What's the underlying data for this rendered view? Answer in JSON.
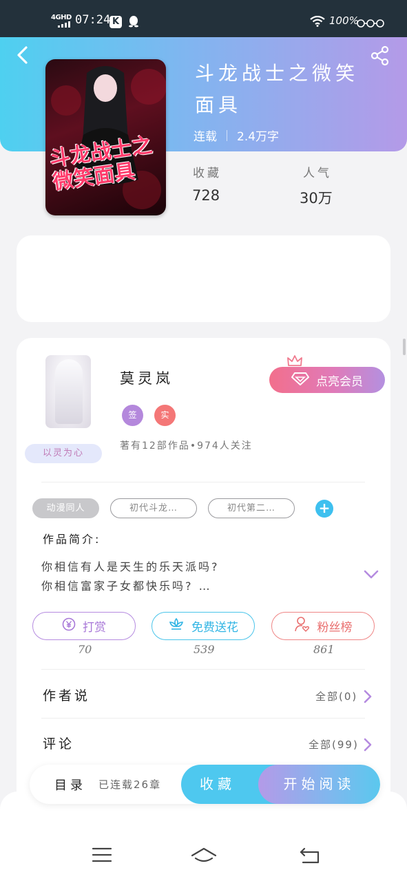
{
  "status_bar": {
    "network": "4GHD",
    "time": "07:24",
    "app_k": "K",
    "battery": "100%"
  },
  "book": {
    "title": "斗龙战士之微笑面具",
    "cover_art_text": "斗龙战士之微笑面具",
    "status": "连载",
    "word_count": "2.4万字",
    "favorites_label": "收藏",
    "favorites_value": "728",
    "popularity_label": "人气",
    "popularity_value": "30万"
  },
  "author": {
    "name": "莫灵岚",
    "badge_signed": "签",
    "badge_real": "实",
    "avatar_badge": "以灵为心",
    "stats": "著有12部作品•974人关注",
    "vip_button": "点亮会员"
  },
  "tags": [
    "动漫同人",
    "初代斗龙…",
    "初代第二…"
  ],
  "intro": {
    "label": "作品简介:",
    "line1": "你相信有人是天生的乐天派吗?",
    "line2": "你相信富家子女都快乐吗? …"
  },
  "actions": [
    {
      "label": "打赏",
      "count": "70",
      "icon": "yen-coin-icon"
    },
    {
      "label": "免费送花",
      "count": "539",
      "icon": "flower-icon"
    },
    {
      "label": "粉丝榜",
      "count": "861",
      "icon": "user-heart-icon"
    }
  ],
  "rows": {
    "author_says": {
      "label": "作者说",
      "right": "全部(0)"
    },
    "comments": {
      "label": "评论",
      "right": "全部(99)"
    }
  },
  "read_bar": {
    "toc": "目录",
    "progress": "已连载26章",
    "favorite": "收藏",
    "start_reading": "开始阅读"
  },
  "colors": {
    "header_start": "#4ed0f0",
    "header_end": "#b49ae8",
    "accent_blue": "#4ec8ef",
    "accent_purple": "#b58be0",
    "accent_red": "#ef8585"
  }
}
